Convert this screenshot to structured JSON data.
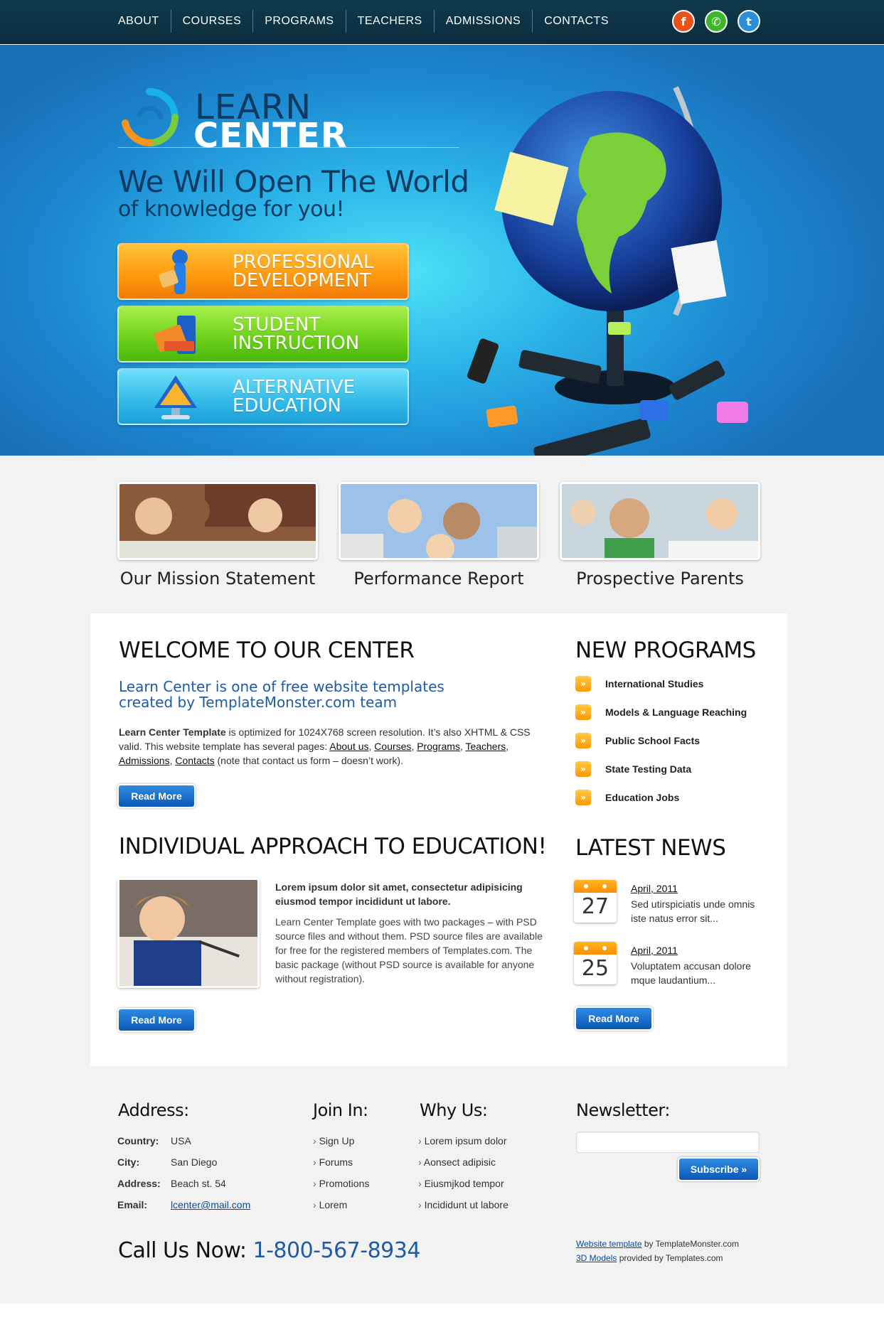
{
  "nav": {
    "items": [
      "ABOUT",
      "COURSES",
      "PROGRAMS",
      "TEACHERS",
      "ADMISSIONS",
      "CONTACTS"
    ],
    "social": [
      {
        "icon": "feed-icon",
        "glyph": "f",
        "color": "#e9521b"
      },
      {
        "icon": "chat-icon",
        "glyph": "✆",
        "color": "#3fb62a"
      },
      {
        "icon": "twitter-icon",
        "glyph": "t",
        "color": "#2a8fd6"
      }
    ]
  },
  "hero": {
    "logo_line1": "LEARN",
    "logo_line2": "CENTER",
    "headline": "We Will Open The World",
    "subheadline": "of knowledge for you!",
    "buttons": [
      {
        "label": "PROFESSIONAL DEVELOPMENT",
        "color": "#ff9b0f"
      },
      {
        "label": "STUDENT INSTRUCTION",
        "color": "#6fd21a"
      },
      {
        "label": "ALTERNATIVE EDUCATION",
        "color": "#34bde9"
      }
    ]
  },
  "features": [
    {
      "caption": "Our Mission Statement"
    },
    {
      "caption": "Performance Report"
    },
    {
      "caption": "Prospective Parents"
    }
  ],
  "welcome": {
    "title": "WELCOME TO OUR CENTER",
    "lead": "Learn Center is one of free website templates created by TemplateMonster.com team",
    "body_strong": "Learn Center Template",
    "body_text": " is optimized for 1024X768 screen resolution. It’s also XHTML & CSS valid. This website template has several pages: ",
    "links": [
      "About us",
      "Courses",
      "Programs",
      "Teachers",
      "Admissions",
      "Contacts"
    ],
    "body_tail": " (note that contact us form – doesn’t work).",
    "read_more": "Read More"
  },
  "approach": {
    "title": "INDIVIDUAL APPROACH TO EDUCATION!",
    "lead": "Lorem ipsum dolor sit amet, consectetur adipisicing eiusmod tempor incididunt ut labore.",
    "body": "Learn Center Template goes with two packages – with PSD source files and without them. PSD source files are available for free for the registered members of Templates.com. The basic package (without PSD source is available for anyone without registration).",
    "read_more": "Read More"
  },
  "programs": {
    "title": "NEW PROGRAMS",
    "items": [
      "International Studies",
      "Models & Language Reaching",
      "Public School Facts",
      "State Testing Data",
      "Education Jobs"
    ]
  },
  "news": {
    "title": "LATEST NEWS",
    "items": [
      {
        "day": "27",
        "date": "April, 2011",
        "text": "Sed utirspiciatis unde omnis iste natus error sit..."
      },
      {
        "day": "25",
        "date": "April, 2011",
        "text": "Voluptatem accusan dolore mque laudantium..."
      }
    ],
    "read_more": "Read More"
  },
  "footer": {
    "address_title": "Address:",
    "address": [
      {
        "key": "Country:",
        "value": "USA"
      },
      {
        "key": "City:",
        "value": "San Diego"
      },
      {
        "key": "Address:",
        "value": "Beach st. 54"
      },
      {
        "key": "Email:",
        "value": "lcenter@mail.com"
      }
    ],
    "join_title": "Join In:",
    "join": [
      "Sign Up",
      "Forums",
      "Promotions",
      "Lorem"
    ],
    "why_title": "Why Us:",
    "why": [
      "Lorem ipsum dolor",
      "Aonsect adipisic",
      "Eiusmjkod tempor",
      "Incididunt ut labore"
    ],
    "newsletter_title": "Newsletter:",
    "newsletter_value": "",
    "subscribe": "Subscribe »",
    "call_label": "Call Us Now: ",
    "call_number": "1-800-567-8934",
    "credit1_link": "Website template",
    "credit1_text": " by TemplateMonster.com",
    "credit2_link": "3D Models",
    "credit2_text": " provided by Templates.com"
  }
}
